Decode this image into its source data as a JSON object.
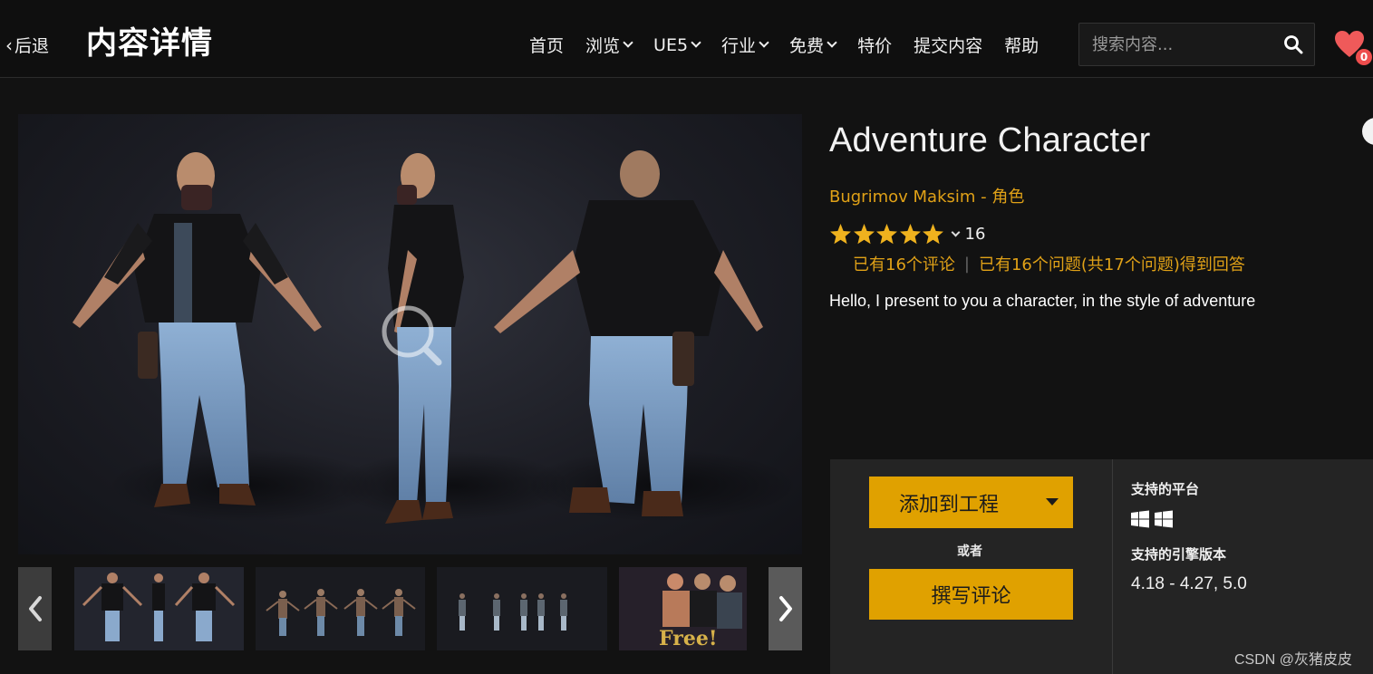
{
  "header": {
    "back_label": "后退",
    "page_title": "内容详情",
    "nav": [
      {
        "label": "首页",
        "dropdown": false
      },
      {
        "label": "浏览",
        "dropdown": true
      },
      {
        "label": "UE5",
        "dropdown": true
      },
      {
        "label": "行业",
        "dropdown": true
      },
      {
        "label": "免费",
        "dropdown": true
      },
      {
        "label": "特价",
        "dropdown": false
      },
      {
        "label": "提交内容",
        "dropdown": false
      },
      {
        "label": "帮助",
        "dropdown": false
      }
    ],
    "search_placeholder": "搜索内容...",
    "wishlist_count": "0",
    "icons": {
      "search": "search-icon",
      "wishlist": "heart-icon"
    }
  },
  "gallery": {
    "zoom_icon": "magnifier-icon",
    "thumbnail_count": 4,
    "thumbnail_free_label": "Free!",
    "icons": {
      "prev": "chevron-left-icon",
      "next": "chevron-right-icon"
    }
  },
  "product": {
    "title": "Adventure Character",
    "author": "Bugrimov Maksim",
    "separator": "-",
    "category": "角色",
    "rating_stars": 5,
    "rating_count": "16",
    "reviews_text": "已有16个评论",
    "questions_text": "已有16个问题(共17个问题)得到回答",
    "description": "Hello, I present to you a character, in the style of adventure"
  },
  "actions": {
    "add_to_project": "添加到工程",
    "or": "或者",
    "write_review": "撰写评论"
  },
  "specs": {
    "platforms_label": "支持的平台",
    "platform_icons": [
      "windows-icon",
      "windows-icon"
    ],
    "engine_label": "支持的引擎版本",
    "engine_versions": "4.18 - 4.27, 5.0"
  },
  "watermark": "CSDN @灰猪皮皮",
  "colors": {
    "accent": "#e0a100",
    "accent_text": "#e0a117",
    "background": "#121212",
    "panel": "#242424",
    "badge": "#ee4d4d"
  }
}
